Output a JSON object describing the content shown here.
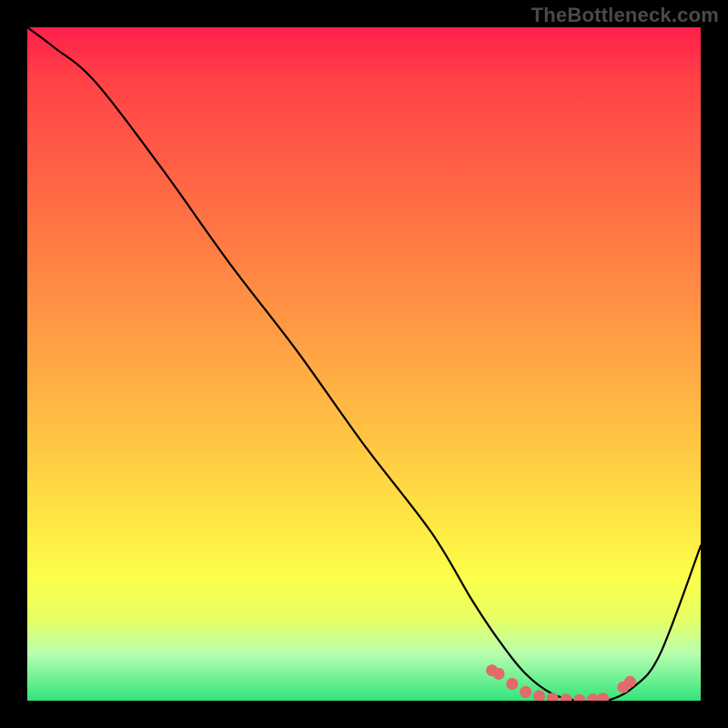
{
  "watermark": "TheBottleneck.com",
  "chart_data": {
    "type": "line",
    "title": "",
    "xlabel": "",
    "ylabel": "",
    "xlim": [
      0,
      100
    ],
    "ylim": [
      0,
      100
    ],
    "background_gradient": {
      "top_color": "#ff1f4a",
      "bottom_color": "#32e47b",
      "orientation": "vertical",
      "meaning": "bottleneck severity (red=high, green=none)"
    },
    "series": [
      {
        "name": "bottleneck-curve",
        "x": [
          0,
          4,
          10,
          20,
          30,
          40,
          50,
          60,
          66,
          70,
          74,
          78,
          82,
          86,
          90,
          94,
          100
        ],
        "y": [
          100,
          97,
          92,
          79,
          65,
          52,
          38,
          25,
          15,
          9,
          4,
          1,
          0,
          0,
          2,
          7,
          23
        ],
        "stroke": "#000000",
        "stroke_width": 2
      }
    ],
    "markers": {
      "name": "highlighted-near-optimal",
      "color": "#e26a6a",
      "points": [
        {
          "x": 69,
          "y": 4.5
        },
        {
          "x": 70,
          "y": 4.0
        },
        {
          "x": 72,
          "y": 2.5
        },
        {
          "x": 74,
          "y": 1.3
        },
        {
          "x": 76,
          "y": 0.7
        },
        {
          "x": 78,
          "y": 0.3
        },
        {
          "x": 80,
          "y": 0.15
        },
        {
          "x": 82,
          "y": 0.1
        },
        {
          "x": 84,
          "y": 0.2
        },
        {
          "x": 85.5,
          "y": 0.3
        },
        {
          "x": 88.5,
          "y": 2.0
        },
        {
          "x": 89.5,
          "y": 2.8
        }
      ]
    }
  }
}
